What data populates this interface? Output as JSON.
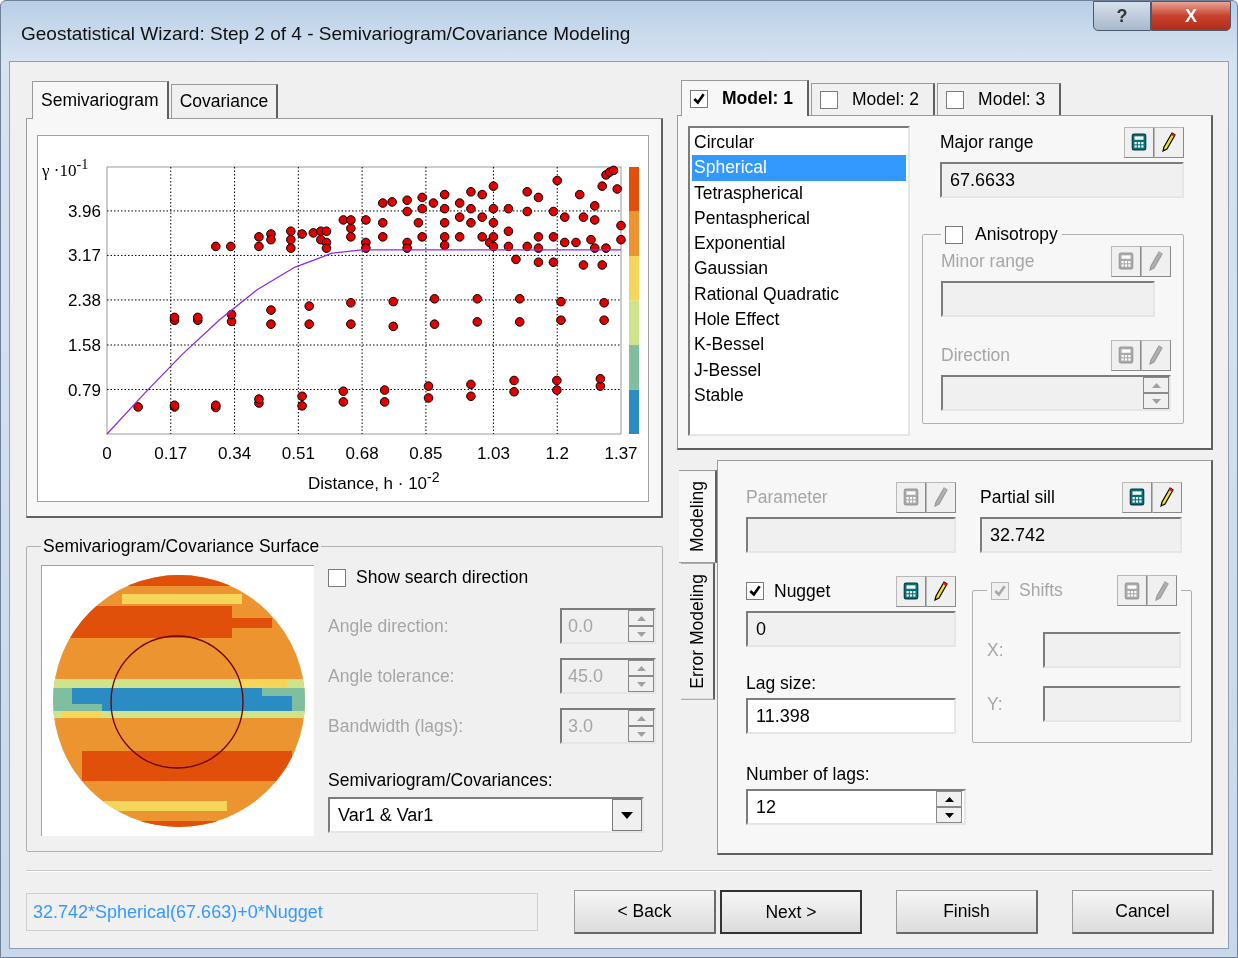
{
  "window": {
    "title": "Geostatistical Wizard: Step 2 of 4 - Semivariogram/Covariance Modeling",
    "help_button": "?",
    "close_button": "X"
  },
  "plot_tabs": [
    {
      "label": "Semivariogram",
      "selected": true
    },
    {
      "label": "Covariance",
      "selected": false
    }
  ],
  "semivariogram_plot": {
    "chart_data": {
      "type": "scatter",
      "xlabel": "Distance, h · 10$^{-2}$",
      "ylabel": "γ ·10$^{-1}$",
      "grid": true,
      "xlim": [
        0,
        1.37
      ],
      "ylim": [
        0,
        4.74
      ],
      "xticks": [
        0,
        0.17,
        0.34,
        0.51,
        0.68,
        0.85,
        1.03,
        1.2,
        1.37
      ],
      "yticks": [
        0.79,
        1.58,
        2.38,
        3.17,
        3.96
      ],
      "series": [
        {
          "color": "#e00000",
          "x": [
            0.083,
            0.18,
            0.18,
            0.29,
            0.29,
            0.405,
            0.405,
            0.52,
            0.52,
            0.63,
            0.63,
            0.74,
            0.74,
            0.857,
            0.857,
            0.97,
            0.97,
            1.085,
            1.085,
            1.199,
            1.199,
            1.315,
            1.315,
            0.18,
            0.18,
            0.242,
            0.242,
            0.332,
            0.332,
            0.437,
            0.437,
            0.539,
            0.539,
            0.65,
            0.65,
            0.763,
            0.763,
            0.873,
            0.873,
            0.987,
            0.987,
            1.1,
            1.1,
            1.21,
            1.21,
            1.325,
            1.325,
            0.29,
            0.33,
            0.405,
            0.405,
            0.437,
            0.437,
            0.49,
            0.49,
            0.49,
            0.52,
            0.55,
            0.57,
            0.57,
            0.585,
            0.585,
            0.585,
            0.63,
            0.65,
            0.65,
            0.65,
            0.69,
            0.69,
            0.69,
            0.735,
            0.735,
            0.735,
            0.76,
            0.8,
            0.8,
            0.8,
            0.8,
            0.83,
            0.84,
            0.84,
            0.84,
            0.87,
            0.9,
            0.9,
            0.9,
            0.9,
            0.9,
            0.94,
            0.94,
            0.94,
            0.97,
            0.97,
            0.97,
            1.0,
            1.0,
            1.0,
            1.02,
            1.03,
            1.03,
            1.03,
            1.03,
            1.03,
            1.07,
            1.07,
            1.07,
            1.09,
            1.12,
            1.12,
            1.12,
            1.15,
            1.15,
            1.15,
            1.15,
            1.19,
            1.19,
            1.19,
            1.2,
            1.22,
            1.22,
            1.25,
            1.26,
            1.27,
            1.27,
            1.29,
            1.3,
            1.3,
            1.3,
            1.32,
            1.33,
            1.34,
            1.35,
            1.36,
            1.37,
            1.37,
            1.32,
            1.33
          ],
          "values": [
            0.48,
            0.48,
            0.51,
            0.47,
            0.51,
            0.55,
            0.62,
            0.5,
            0.67,
            0.57,
            0.76,
            0.57,
            0.78,
            0.64,
            0.85,
            0.67,
            0.88,
            0.75,
            0.95,
            0.78,
            0.95,
            0.85,
            0.98,
            2.02,
            2.07,
            2.02,
            2.07,
            2.0,
            2.12,
            1.95,
            2.2,
            1.95,
            2.27,
            1.95,
            2.33,
            1.91,
            2.35,
            1.95,
            2.4,
            1.99,
            2.4,
            1.99,
            2.4,
            2.02,
            2.35,
            2.02,
            2.33,
            3.33,
            3.33,
            3.33,
            3.5,
            3.55,
            3.45,
            3.6,
            3.45,
            3.3,
            3.55,
            3.57,
            3.6,
            3.45,
            3.6,
            3.4,
            3.3,
            3.8,
            3.8,
            3.65,
            3.5,
            3.8,
            3.4,
            3.3,
            4.1,
            3.75,
            3.5,
            4.12,
            4.15,
            3.95,
            3.4,
            3.3,
            3.75,
            4.2,
            4.0,
            3.5,
            4.1,
            4.25,
            4.0,
            3.75,
            3.5,
            3.35,
            4.1,
            3.85,
            3.5,
            4.3,
            4.0,
            3.75,
            4.25,
            3.85,
            3.5,
            3.4,
            4.4,
            4.0,
            3.75,
            3.5,
            3.33,
            4.0,
            3.6,
            3.33,
            3.1,
            4.3,
            3.95,
            3.33,
            4.2,
            3.5,
            3.3,
            3.05,
            3.95,
            3.5,
            3.05,
            4.5,
            3.85,
            3.4,
            3.4,
            4.25,
            3.85,
            3.0,
            3.45,
            4.05,
            3.8,
            3.3,
            4.4,
            4.6,
            4.65,
            4.68,
            4.35,
            3.7,
            3.45,
            3.0,
            3.3
          ]
        },
        {
          "type": "line",
          "color": "#8a2be2",
          "x": [
            0,
            0.1,
            0.2,
            0.3,
            0.4,
            0.5,
            0.6,
            0.68,
            1.37
          ],
          "values": [
            0,
            0.72,
            1.41,
            2.03,
            2.56,
            2.96,
            3.21,
            3.27,
            3.27
          ]
        }
      ]
    }
  },
  "surface_group": {
    "title": "Semivariogram/Covariance Surface",
    "show_search_direction": {
      "label": "Show search direction",
      "checked": false
    },
    "fields": [
      {
        "label": "Angle direction:",
        "value": "0.0",
        "disabled": true
      },
      {
        "label": "Angle tolerance:",
        "value": "45.0",
        "disabled": true
      },
      {
        "label": "Bandwidth (lags):",
        "value": "3.0",
        "disabled": true
      }
    ],
    "covariances": {
      "label": "Semivariogram/Covariances:",
      "value": "Var1 & Var1"
    }
  },
  "model_tabs": [
    {
      "label": "Model:  1",
      "checked": true,
      "selected": true
    },
    {
      "label": "Model:  2",
      "checked": false,
      "selected": false
    },
    {
      "label": "Model:  3",
      "checked": false,
      "selected": false
    }
  ],
  "model_types": [
    {
      "label": "Circular",
      "selected": false
    },
    {
      "label": "Spherical",
      "selected": true
    },
    {
      "label": "Tetraspherical",
      "selected": false
    },
    {
      "label": "Pentaspherical",
      "selected": false
    },
    {
      "label": "Exponential",
      "selected": false
    },
    {
      "label": "Gaussian",
      "selected": false
    },
    {
      "label": "Rational Quadratic",
      "selected": false
    },
    {
      "label": "Hole Effect",
      "selected": false
    },
    {
      "label": "K-Bessel",
      "selected": false
    },
    {
      "label": "J-Bessel",
      "selected": false
    },
    {
      "label": "Stable",
      "selected": false
    }
  ],
  "major_range": {
    "label": "Major range",
    "value": "67.6633",
    "disabled": false
  },
  "anisotropy": {
    "label": "Anisotropy",
    "checked": false,
    "minor_range": {
      "label": "Minor range",
      "disabled": true
    },
    "direction": {
      "label": "Direction",
      "disabled": true
    }
  },
  "modeling_tabs": [
    {
      "label": "Modeling",
      "selected": true
    },
    {
      "label": "Error Modeling",
      "selected": false
    }
  ],
  "parameter": {
    "label": "Parameter",
    "disabled": true
  },
  "partial_sill": {
    "label": "Partial sill",
    "value": "32.742",
    "disabled": false
  },
  "nugget": {
    "label": "Nugget",
    "checked": true,
    "value": "0"
  },
  "shifts": {
    "label": "Shifts",
    "checked": true,
    "disabled": true,
    "x_label": "X:",
    "y_label": "Y:"
  },
  "lag_size": {
    "label": "Lag size:",
    "value": "11.398"
  },
  "number_of_lags": {
    "label": "Number of lags:",
    "value": "12"
  },
  "formula": "32.742*Spherical(67.663)+0*Nugget",
  "buttons": [
    {
      "label": "< Back",
      "default": false
    },
    {
      "label": "Next >",
      "default": true
    },
    {
      "label": "Finish",
      "default": false
    },
    {
      "label": "Cancel",
      "default": false
    }
  ]
}
